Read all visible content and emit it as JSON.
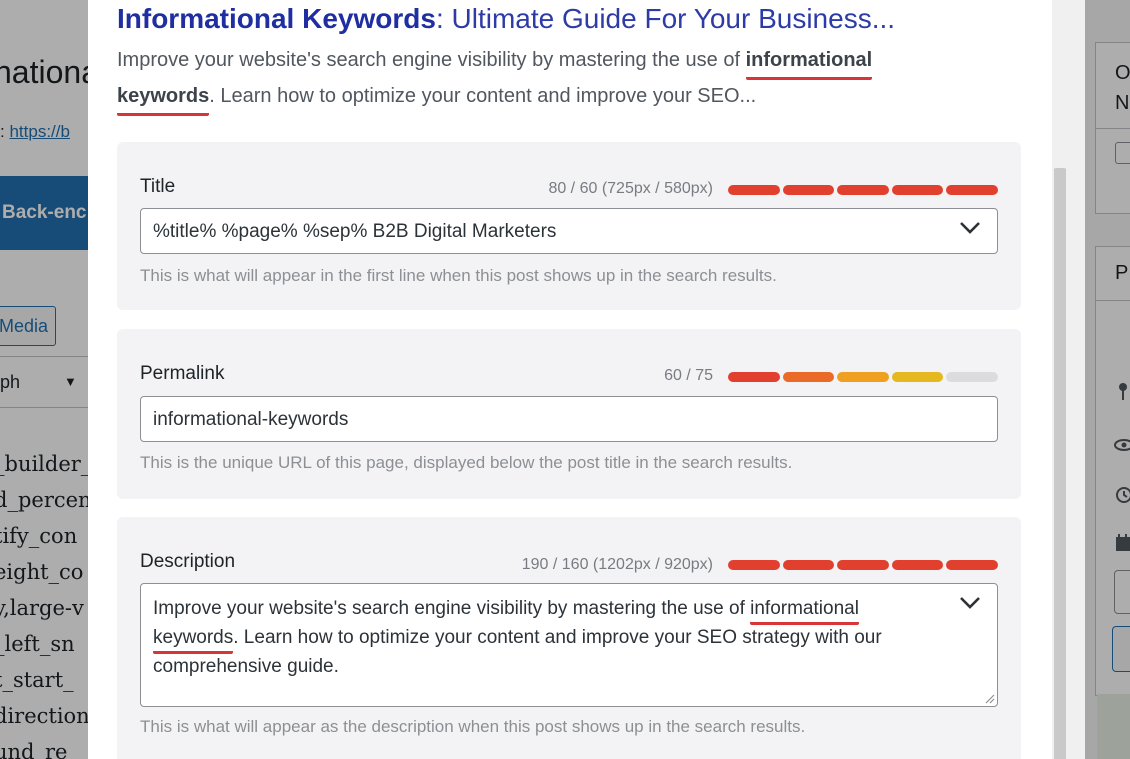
{
  "background": {
    "heading_fragment": "nationa",
    "link_prefix": ":",
    "link_text": "https://b",
    "blue_button_label": "Back-enc",
    "media_button_label": "Media",
    "paragraph_select": "ph",
    "code_lines": [
      "_builder_",
      "d_percen",
      "tify_con",
      "eight_co",
      "y,large-v",
      "_left_sn",
      "t_start_",
      "direction",
      "und_re"
    ],
    "right_panel": {
      "top_letter": "O",
      "second_letter": "N",
      "panel_letter": "P"
    }
  },
  "serp_preview": {
    "title_keyword": "Informational Keywords",
    "title_rest": ": Ultimate Guide For Your Business...",
    "desc_part1": "Improve your website's search engine visibility by mastering the use of ",
    "desc_keyword_1": "informational",
    "desc_keyword_2": "keywords",
    "desc_part2": ". Learn how to optimize your content and improve your SEO..."
  },
  "title_section": {
    "label": "Title",
    "counter": "80 / 60 (725px / 580px)",
    "value": "%title% %page% %sep% B2B Digital Marketers",
    "help": "This is what will appear in the first line when this post shows up in the search results.",
    "bar_colors": [
      "#e2402f",
      "#e2402f",
      "#e2402f",
      "#e2402f",
      "#e2402f"
    ]
  },
  "permalink_section": {
    "label": "Permalink",
    "counter": "60 / 75",
    "value": "informational-keywords",
    "help": "This is the unique URL of this page, displayed below the post title in the search results.",
    "bar_fill_fraction": 0.8,
    "bar_colors": [
      "#e2402f",
      "#ea6a28",
      "#efa020",
      "#e4b81e",
      "#a9c03a"
    ]
  },
  "description_section": {
    "label": "Description",
    "counter": "190 / 160 (1202px / 920px)",
    "text_part1": "Improve your website's search engine visibility by mastering the use of ",
    "text_keyword_1": "informational",
    "text_keyword_2": "keywords",
    "text_part2": ". Learn how to optimize your content and improve your SEO strategy with our comprehensive guide.",
    "help": "This is what will appear as the description when this post shows up in the search results.",
    "bar_colors": [
      "#e2402f",
      "#e2402f",
      "#e2402f",
      "#e2402f",
      "#e2402f"
    ]
  },
  "colors": {
    "serp_title": "#1f2ea0",
    "keyword_underline": "#d63638",
    "field_border": "#8c8f94",
    "card_background": "#f3f3f5"
  }
}
